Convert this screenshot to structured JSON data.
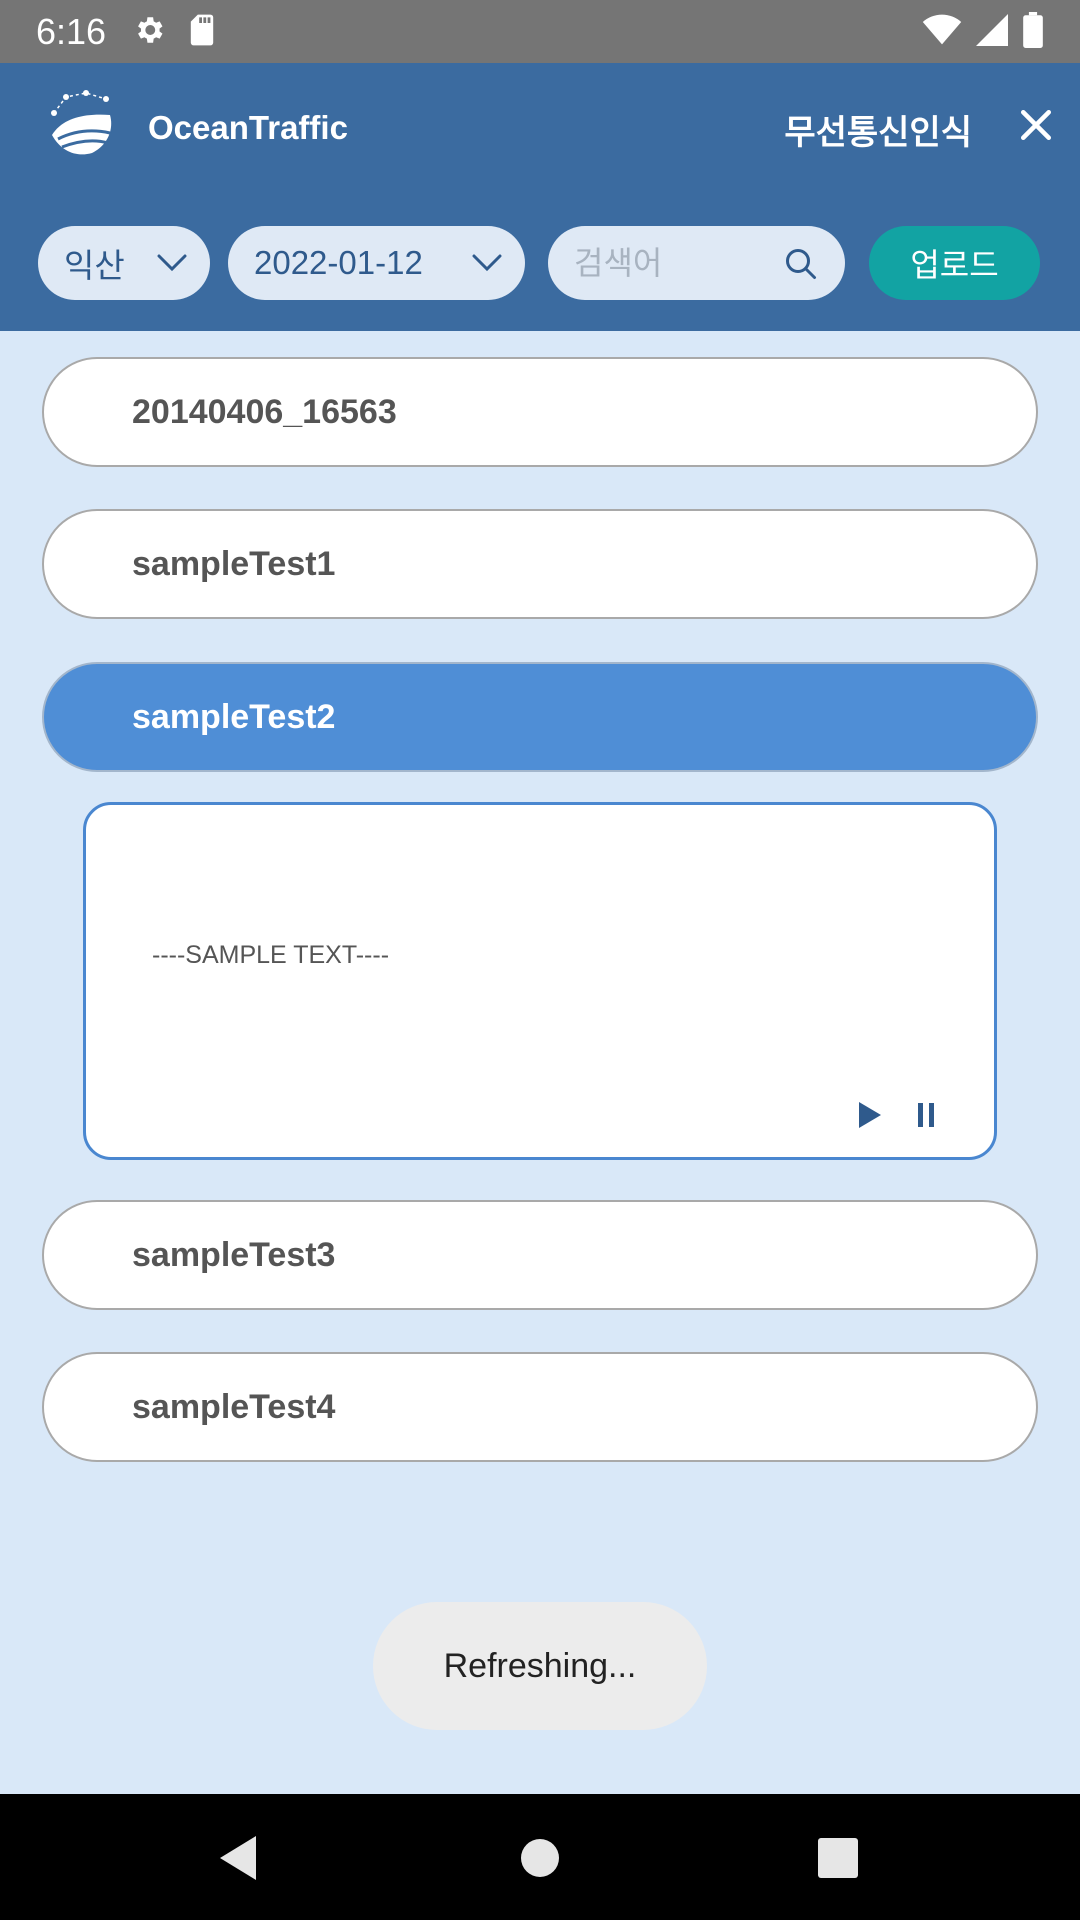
{
  "status_bar": {
    "time": "6:16",
    "icons": [
      "settings-icon",
      "sd-card-icon",
      "wifi-icon",
      "signal-icon",
      "battery-icon"
    ]
  },
  "header": {
    "app_name": "OceanTraffic",
    "title": "무선통신인식",
    "close_icon": "close-icon",
    "logo_icon": "ship-logo-icon"
  },
  "filters": {
    "region": "익산",
    "date": "2022-01-12",
    "search_placeholder": "검색어",
    "search_value": "",
    "upload_label": "업로드"
  },
  "list": {
    "items": [
      {
        "label": "20140406_16563",
        "selected": false
      },
      {
        "label": "sampleTest1",
        "selected": false
      },
      {
        "label": "sampleTest2",
        "selected": true
      },
      {
        "label": "sampleTest3",
        "selected": false
      },
      {
        "label": "sampleTest4",
        "selected": false
      }
    ]
  },
  "detail": {
    "text": "----SAMPLE TEXT----",
    "play_icon": "play-icon",
    "pause_icon": "pause-icon"
  },
  "toast": {
    "text": "Refreshing..."
  },
  "nav_bar": {
    "icons": [
      "back-icon",
      "home-icon",
      "recents-icon"
    ]
  },
  "colors": {
    "header": "#3b6ba0",
    "background": "#d9e8f8",
    "selected": "#4f8ed6",
    "upload": "#12a3a3"
  }
}
